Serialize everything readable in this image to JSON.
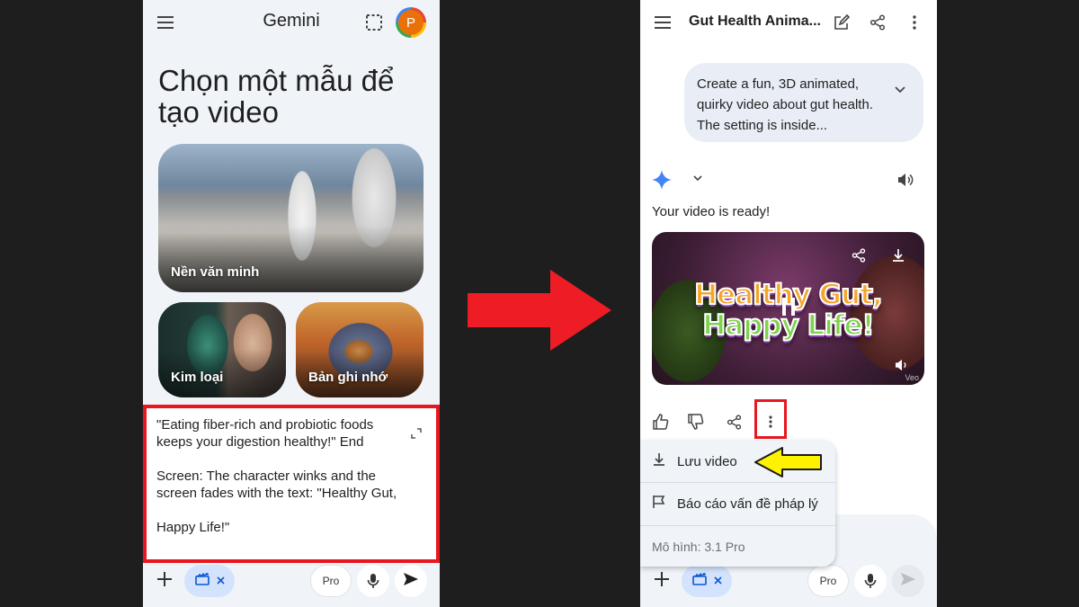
{
  "left_screen": {
    "app_title": "Gemini",
    "avatar_letter": "P",
    "heading": "Chọn một mẫu để tạo video",
    "templates": [
      {
        "label": "Nền văn minh"
      },
      {
        "label": "Kim loại"
      },
      {
        "label": "Bản ghi nhớ"
      }
    ],
    "prompt_lines": [
      "\"Eating fiber-rich and probiotic foods keeps your digestion healthy!\" End",
      "Screen: The character winks and the screen fades with the text: \"Healthy Gut,",
      "Happy Life!\""
    ],
    "pro_label": "Pro"
  },
  "right_screen": {
    "chat_title": "Gut Health Anima...",
    "user_prompt": "Create a fun, 3D animated, quirky video about gut health. The setting is inside...",
    "response_text": "Your video is ready!",
    "video_title_line1": "Healthy Gut,",
    "video_title_line2": "Happy Life!",
    "video_watermark": "Veo",
    "menu": {
      "save_video": "Lưu video",
      "report_legal": "Báo cáo vấn đề pháp lý",
      "model_label": "Mô hình: 3.1 Pro"
    },
    "pro_label": "Pro"
  },
  "colors": {
    "highlight_red": "#e8161f",
    "arrow_red": "#ee1c25",
    "pointer_yellow": "#fff200",
    "chip_blue": "#d3e3fd",
    "gemini_blue": "#4285f4"
  },
  "icons": [
    "menu-icon",
    "select-icon",
    "expand-icon",
    "plus-icon",
    "clapperboard-icon",
    "close-icon",
    "mic-icon",
    "send-icon",
    "edit-icon",
    "share-icon",
    "more-vert-icon",
    "chevron-down-icon",
    "sparkle-icon",
    "volume-icon",
    "download-icon",
    "pause-icon",
    "thumb-up-icon",
    "thumb-down-icon",
    "flag-icon"
  ]
}
